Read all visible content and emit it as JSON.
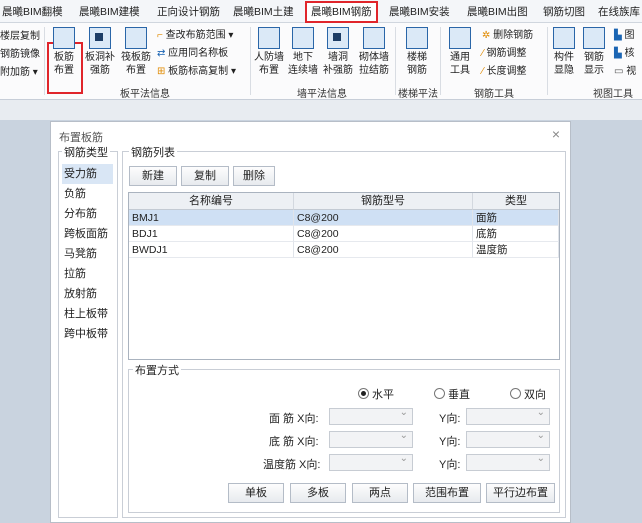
{
  "tabs": [
    "晨曦BIM翻模",
    "晨曦BIM建模",
    "正向设计钢筋",
    "晨曦BIM土建",
    "晨曦BIM钢筋",
    "晨曦BIM安装",
    "晨曦BIM出图",
    "钢筋切图",
    "在线族库"
  ],
  "ribbon": {
    "left_items": [
      "楼层复制",
      "钢筋镜像",
      "附加筋 ▾"
    ],
    "b1_l1": "板筋",
    "b1_l2": "布置",
    "b2_l1": "板洞补",
    "b2_l2": "强筋",
    "b3_l1": "筏板筋",
    "b3_l2": "布置",
    "cmd1": "查改布筋范围 ▾",
    "cmd2": "应用同名称板",
    "cmd3": "板筋标高复制 ▾",
    "grp1": "板平法信息",
    "b4_l1": "人防墙",
    "b4_l2": "布置",
    "b5_l1": "地下",
    "b5_l2": "连续墙",
    "b6_l1": "墙洞",
    "b6_l2": "补强筋",
    "b7_l1": "砌体墙",
    "b7_l2": "拉结筋",
    "grp2": "墙平法信息",
    "b8_l1": "楼梯",
    "b8_l2": "钢筋",
    "grp3": "楼梯平法",
    "b9_l1": "通用",
    "b9_l2": "工具",
    "cmd4": "删除钢筋",
    "cmd5": "钢筋调整",
    "cmd6": "长度调整",
    "grp4": "钢筋工具",
    "b10_l1": "构件",
    "b10_l2": "显隐",
    "b11_l1": "钢筋",
    "b11_l2": "显示",
    "grp5": "视图工具",
    "cmd7": "图",
    "cmd8": "核",
    "cmd9": "视"
  },
  "dialog": {
    "title": "布置板筋",
    "close": "×",
    "types_legend": "钢筋类型",
    "types": [
      "受力筋",
      "负筋",
      "分布筋",
      "跨板面筋",
      "马凳筋",
      "拉筋",
      "放射筋",
      "柱上板带",
      "跨中板带"
    ],
    "list_legend": "钢筋列表",
    "btn_new": "新建",
    "btn_copy": "复制",
    "btn_delete": "删除",
    "columns": [
      "名称编号",
      "钢筋型号",
      "类型"
    ],
    "rows": [
      {
        "name": "BMJ1",
        "spec": "C8@200",
        "type": "面筋"
      },
      {
        "name": "BDJ1",
        "spec": "C8@200",
        "type": "底筋"
      },
      {
        "name": "BWDJ1",
        "spec": "C8@200",
        "type": "温度筋"
      }
    ],
    "mode_legend": "布置方式",
    "radio_h": "水平",
    "radio_v": "垂直",
    "radio_b": "双向",
    "lbl_face": "面 筋 X向:",
    "lbl_bottom": "底 筋 X向:",
    "lbl_temp": "温度筋 X向:",
    "lbl_y": "Y向:",
    "btn_single": "单板",
    "btn_multi": "多板",
    "btn_two": "两点",
    "btn_range": "范围布置",
    "btn_parallel": "平行边布置"
  }
}
